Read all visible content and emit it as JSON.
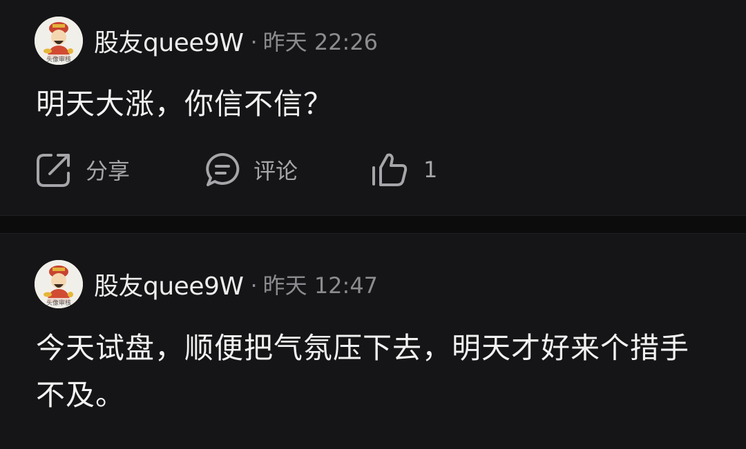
{
  "posts": [
    {
      "username": "股友quee9W",
      "separator": "·",
      "time": "昨天 22:26",
      "avatar_text": "头像审核",
      "content": "明天大涨，你信不信？",
      "actions": {
        "share_label": "分享",
        "comment_label": "评论",
        "like_count": "1"
      }
    },
    {
      "username": "股友quee9W",
      "separator": "·",
      "time": "昨天 12:47",
      "avatar_text": "头像审核",
      "content": "今天试盘，顺便把气氛压下去，明天才好来个措手不及。"
    }
  ],
  "icons": {
    "share": "share-icon",
    "comment": "comment-icon",
    "like": "thumbs-up-icon"
  },
  "colors": {
    "background": "#151517",
    "divider": "#0c0c0d",
    "text_primary": "#f2f2f2",
    "text_secondary": "#8c8c90",
    "action_text": "#a6a6aa"
  }
}
